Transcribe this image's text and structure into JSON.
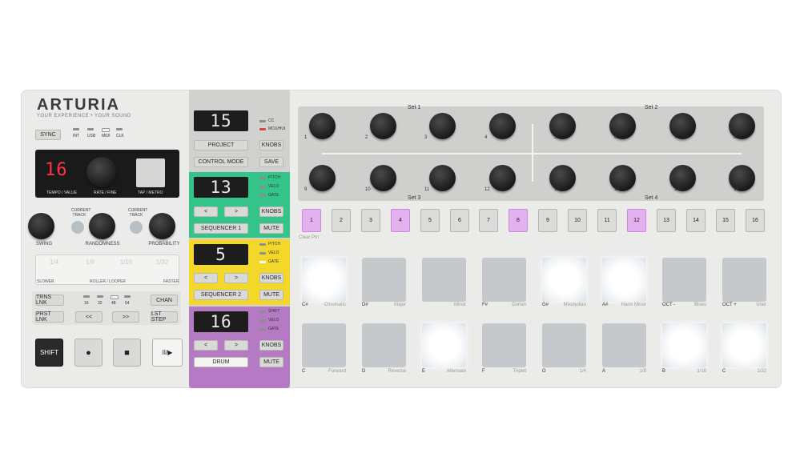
{
  "brand": {
    "logo": "ARTURIA",
    "tagline": "YOUR EXPERIENCE • YOUR SOUND"
  },
  "left": {
    "sync": "SYNC",
    "sync_leds": [
      "INT",
      "USB",
      "MIDI",
      "CLK"
    ],
    "tempo_display": "16",
    "tempo_label": "TEMPO / VALUE",
    "rate_label": "RATE / FINE",
    "tap_label": "TAP / METRO",
    "current_track_1": "CURRENT\nTRACK",
    "current_track_2": "CURRENT\nTRACK",
    "swing": "SWING",
    "randomness": "RANDOMNESS",
    "probability": "PROBABILITY",
    "roller_cells": [
      "1/4",
      "1/8",
      "1/16",
      "1/32"
    ],
    "slower": "SLOWER",
    "roller": "ROLLER / LOOPER",
    "faster": "FASTER",
    "trns_lnk": "TRNS LNK",
    "prst_lnk": "PRST LNK",
    "chan": "CHAN",
    "lst_step": "LST STEP",
    "rewind": "<<",
    "forward": ">>",
    "length_leds": [
      "16",
      "32",
      "48",
      "64"
    ],
    "shift": "SHIFT",
    "record_icon": "●",
    "stop_icon": "■",
    "play_icon": "II/▶"
  },
  "mid": {
    "project_display": "15",
    "project": "PROJECT",
    "control_mode": "CONTROL MODE",
    "knobs": "KNOBS",
    "save": "SAVE",
    "cc": "CC",
    "mcu": "MCU/HUI",
    "seq1_display": "13",
    "seq1": "SEQUENCER 1",
    "seq2_display": "5",
    "seq2": "SEQUENCER 2",
    "drum_display": "16",
    "drum": "DRUM",
    "mute": "MUTE",
    "pitch": "PITCH",
    "velo": "VELO",
    "gate": "GATE",
    "shift_led": "SHIFT",
    "left_arrow": "<",
    "right_arrow": ">"
  },
  "right": {
    "set1": "Set 1",
    "set2": "Set 2",
    "set3": "Set 3",
    "set4": "Set 4",
    "clear_ptn": "Clear Ptn",
    "steps": [
      "1",
      "2",
      "3",
      "4",
      "5",
      "6",
      "7",
      "8",
      "9",
      "10",
      "11",
      "12",
      "13",
      "14",
      "15",
      "16"
    ],
    "steps_on": [
      1,
      4,
      8,
      12
    ],
    "pad_row1_notes": [
      "C#",
      "D#",
      "",
      "F#",
      "G#",
      "A#",
      "OCT -",
      "OCT +"
    ],
    "pad_row1_funcs": [
      "Chromatic",
      "Major",
      "Minor",
      "Dorian",
      "Mixolydian",
      "Harm Minor",
      "Blues",
      "User"
    ],
    "pad_row1_lit": [
      true,
      false,
      false,
      false,
      true,
      true,
      false,
      false
    ],
    "pad_row2_notes": [
      "C",
      "D",
      "E",
      "F",
      "G",
      "A",
      "B",
      "C"
    ],
    "pad_row2_funcs": [
      "Forward",
      "Reverse",
      "Alternate",
      "Triplet",
      "1/4",
      "1/8",
      "1/16",
      "1/32"
    ],
    "pad_row2_lit": [
      false,
      false,
      true,
      false,
      false,
      false,
      true,
      true
    ]
  },
  "colors": {
    "seq1": "#34c48a",
    "seq2": "#f3d82a",
    "drum": "#b57ac4",
    "step_on": "#e3b2ee",
    "display_red": "#ff3344"
  }
}
